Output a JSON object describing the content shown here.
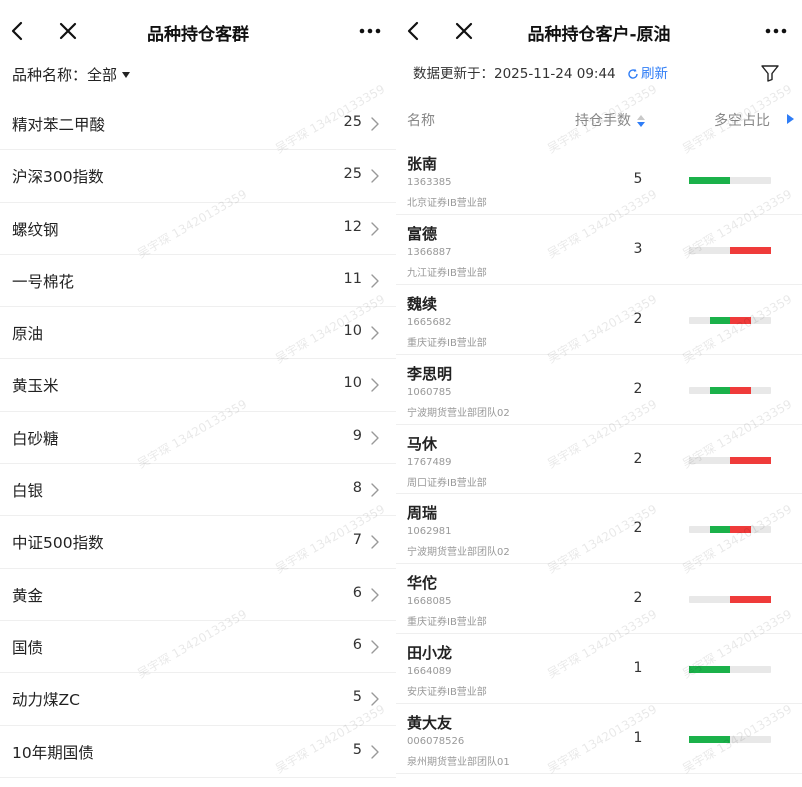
{
  "left": {
    "title": "品种持仓客群",
    "filter_label": "品种名称：全部",
    "varieties": [
      {
        "name": "精对苯二甲酸",
        "count": "25"
      },
      {
        "name": "沪深300指数",
        "count": "25"
      },
      {
        "name": "螺纹钢",
        "count": "12"
      },
      {
        "name": "一号棉花",
        "count": "11"
      },
      {
        "name": "原油",
        "count": "10"
      },
      {
        "name": "黄玉米",
        "count": "10"
      },
      {
        "name": "白砂糖",
        "count": "9"
      },
      {
        "name": "白银",
        "count": "8"
      },
      {
        "name": "中证500指数",
        "count": "7"
      },
      {
        "name": "黄金",
        "count": "6"
      },
      {
        "name": "国债",
        "count": "6"
      },
      {
        "name": "动力煤ZC",
        "count": "5"
      },
      {
        "name": "10年期国债",
        "count": "5"
      }
    ]
  },
  "right": {
    "title": "品种持仓客户-原油",
    "update_text": "数据更新于：2025-11-24 09:44",
    "refresh_label": "刷新",
    "columns": {
      "name": "名称",
      "position": "持仓手数",
      "ratio": "多空占比"
    },
    "customers": [
      {
        "name": "张南",
        "id": "1363385",
        "branch": "北京证券IB营业部",
        "position": "5",
        "long": 0.5,
        "short": 0
      },
      {
        "name": "富德",
        "id": "1366887",
        "branch": "九江证券IB营业部",
        "position": "3",
        "long": 0,
        "short": 0.5
      },
      {
        "name": "魏续",
        "id": "1665682",
        "branch": "重庆证券IB营业部",
        "position": "2",
        "long": 0.25,
        "short": 0.25
      },
      {
        "name": "李思明",
        "id": "1060785",
        "branch": "宁波期货营业部团队02",
        "position": "2",
        "long": 0.25,
        "short": 0.25
      },
      {
        "name": "马休",
        "id": "1767489",
        "branch": "周口证券IB营业部",
        "position": "2",
        "long": 0,
        "short": 0.5
      },
      {
        "name": "周瑞",
        "id": "1062981",
        "branch": "宁波期货营业部团队02",
        "position": "2",
        "long": 0.25,
        "short": 0.25
      },
      {
        "name": "华佗",
        "id": "1668085",
        "branch": "重庆证券IB营业部",
        "position": "2",
        "long": 0,
        "short": 0.5
      },
      {
        "name": "田小龙",
        "id": "1664089",
        "branch": "安庆证券IB营业部",
        "position": "1",
        "long": 0.5,
        "short": 0
      },
      {
        "name": "黄大友",
        "id": "006078526",
        "branch": "泉州期货营业部团队01",
        "position": "1",
        "long": 0.5,
        "short": 0
      }
    ]
  },
  "watermark": "吴宇琛 13420133359",
  "colors": {
    "long": "#1bb14a",
    "short": "#ef3b3a",
    "accent": "#2f7df6"
  }
}
